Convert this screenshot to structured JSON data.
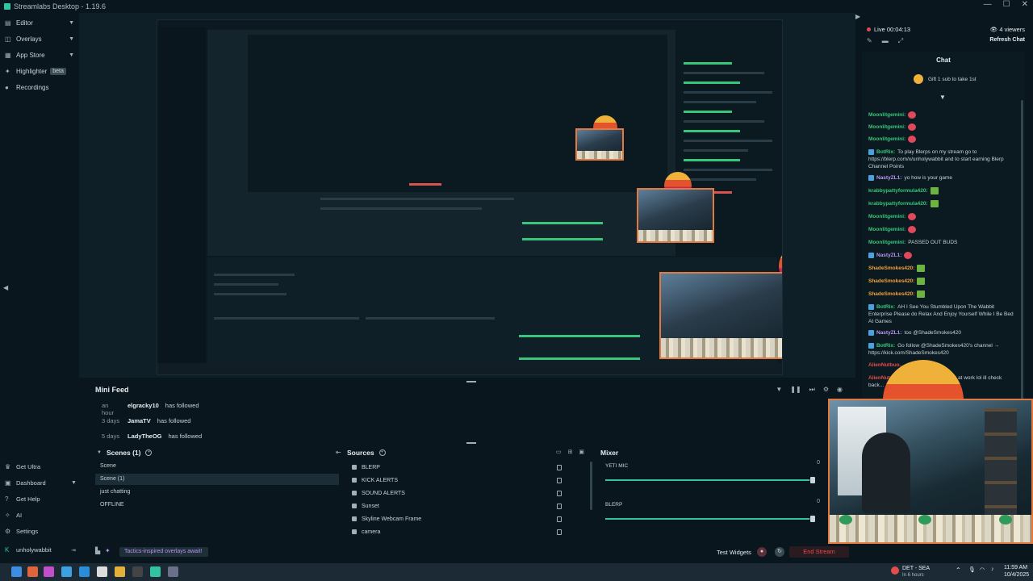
{
  "window": {
    "title": "Streamlabs Desktop - 1.19.6",
    "controls": [
      "—",
      "☐",
      "✕"
    ]
  },
  "nav": {
    "items": [
      {
        "label": "Editor",
        "icon": "editor-icon"
      },
      {
        "label": "Overlays",
        "icon": "overlays-icon"
      },
      {
        "label": "App Store",
        "icon": "store-icon"
      },
      {
        "label": "Highlighter",
        "icon": "highlighter-icon",
        "badge": "beta"
      },
      {
        "label": "Recordings",
        "icon": "recordings-icon"
      }
    ],
    "bottom": [
      {
        "label": "Get Ultra",
        "icon": "ultra-icon"
      },
      {
        "label": "Dashboard",
        "icon": "dashboard-icon"
      },
      {
        "label": "Get Help",
        "icon": "help-icon"
      },
      {
        "label": "AI",
        "icon": "ai-icon"
      },
      {
        "label": "Settings",
        "icon": "gear-icon"
      },
      {
        "label": "unholywabbit",
        "icon": "kick-icon"
      }
    ]
  },
  "minifeed": {
    "title": "Mini Feed",
    "rows": [
      {
        "time": "an hour",
        "user": "elgracky10",
        "action": "has followed"
      },
      {
        "time": "3 days",
        "user": "JamaTV",
        "action": "has followed"
      },
      {
        "time": "5 days",
        "user": "LadyTheOG",
        "action": "has followed"
      }
    ]
  },
  "scenes": {
    "title": "Scenes (1)",
    "items": [
      "Scene",
      "Scene (1)",
      "just chatting",
      "OFFLINE"
    ],
    "selected": 1
  },
  "sources": {
    "title": "Sources",
    "items": [
      "BLERP",
      "KICK ALERTS",
      "SOUND ALERTS",
      "Sunset",
      "Skyline Webcam Frame",
      "camera"
    ]
  },
  "mixer": {
    "title": "Mixer",
    "channels": [
      {
        "name": "YETI MIC",
        "level": 0.99,
        "value": "0"
      },
      {
        "name": "BLERP",
        "level": 0.99,
        "value": "0"
      }
    ]
  },
  "footer": {
    "promo": "Tactics-inspired overlays await!",
    "test_widgets": "Test Widgets",
    "end_stream": "End Stream"
  },
  "chat": {
    "live": "Live 00:04:13",
    "viewers": "4 viewers",
    "refresh": "Refresh Chat",
    "title": "Chat",
    "gift": "Gift 1 sub to take 1st",
    "messages": [
      {
        "user": "Moonlitgemini:",
        "text": "",
        "color": "#39c67a",
        "emote": "red"
      },
      {
        "user": "Moonlitgemini:",
        "text": "",
        "color": "#39c67a",
        "emote": "red"
      },
      {
        "user": "Moonlitgemini:",
        "text": "",
        "color": "#39c67a",
        "emote": "red"
      },
      {
        "user": "BotRix:",
        "text": "To play Blerps on my stream go to https://blerp.com/x/unholywabbit and to start earning Blerp Channel Points",
        "color": "#39c67a",
        "bot": true
      },
      {
        "user": "NastyZL1:",
        "text": "yo how is your game",
        "color": "#b793f0",
        "bot": true
      },
      {
        "user": "krabbypattyformula420:",
        "text": "",
        "color": "#39c67a",
        "emote": "green"
      },
      {
        "user": "krabbypattyformula420:",
        "text": "",
        "color": "#39c67a",
        "emote": "green"
      },
      {
        "user": "Moonlitgemini:",
        "text": "",
        "color": "#39c67a",
        "emote": "red"
      },
      {
        "user": "Moonlitgemini:",
        "text": "",
        "color": "#39c67a",
        "emote": "red"
      },
      {
        "user": "Moonlitgemini:",
        "text": "PASSED OUT BUDS",
        "color": "#39c67a"
      },
      {
        "user": "NastyZL1:",
        "text": "",
        "color": "#b793f0",
        "bot": true,
        "emote": "red"
      },
      {
        "user": "ShadeSmokes420:",
        "text": "",
        "color": "#f0a13a",
        "emote": "green"
      },
      {
        "user": "ShadeSmokes420:",
        "text": "",
        "color": "#f0a13a",
        "emote": "green"
      },
      {
        "user": "ShadeSmokes420:",
        "text": "",
        "color": "#f0a13a",
        "emote": "green"
      },
      {
        "user": "BotRix:",
        "text": "AH I See You Stumbled Upon The Wabbit Enterprise Please do Relax And Enjoy Yourself While I Be Bed At Games",
        "color": "#39c67a",
        "bot": true
      },
      {
        "user": "NastyZL1:",
        "text": "too @ShadeSmokes420",
        "color": "#b793f0",
        "bot": true
      },
      {
        "user": "BotRix:",
        "text": "Go follow @ShadeSmokes420's channel → https://kick.com/ShadeSmokes420",
        "color": "#39c67a",
        "bot": true
      },
      {
        "user": "AlienNutbuo...",
        "text": "",
        "color": "#e24c4c"
      },
      {
        "user": "AlienNutz...",
        "text": "...maybe you sleeping or at work lol ill check back...",
        "color": "#e24c4c"
      }
    ]
  },
  "taskbar": {
    "weather": "DET - SEA",
    "weather_sub": "In 6 hours",
    "time": "11:59 AM",
    "date": "10/4/2025"
  },
  "colors": {
    "bg": "#09161d",
    "accent": "#31c3a2",
    "live": "#e24c4c",
    "frame": "#e27a3f"
  }
}
